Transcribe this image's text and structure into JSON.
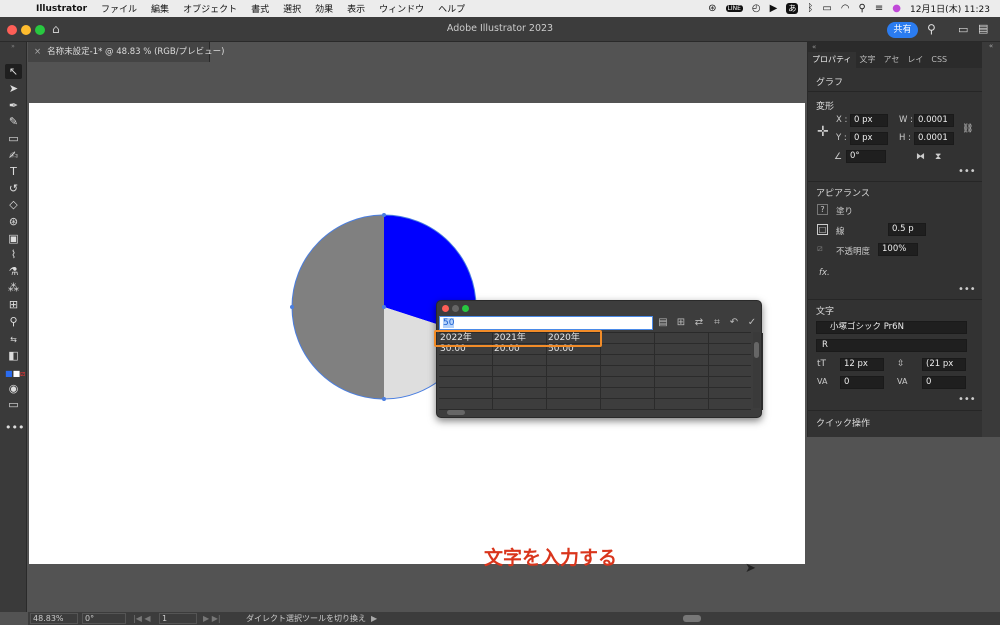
{
  "menubar": {
    "app_name": "Illustrator",
    "items": [
      "ファイル",
      "編集",
      "オブジェクト",
      "書式",
      "選択",
      "効果",
      "表示",
      "ウィンドウ",
      "ヘルプ"
    ],
    "clock": "12月1日(木) 11:23",
    "status_icons": [
      "creative-cloud-icon",
      "line-icon",
      "timer-icon",
      "play-icon",
      "input-method-icon",
      "bluetooth-icon",
      "battery-icon",
      "wifi-icon",
      "spotlight-icon",
      "control-center-icon",
      "siri-icon"
    ],
    "input_method": "あ",
    "line_label": "LINE"
  },
  "window": {
    "title": "Adobe Illustrator 2023",
    "share_label": "共有"
  },
  "document_tab": {
    "close": "×",
    "label": "名称未設定-1* @ 48.83 % (RGB/プレビュー)"
  },
  "canvas": {
    "caption": "文字を入力する",
    "pie_colors": [
      "#0000ff",
      "#dedede",
      "#808080"
    ],
    "pie_values": [
      30,
      20,
      50
    ],
    "selection_color": "#4a7ee0"
  },
  "graph_data": {
    "input_value": "50",
    "rows": [
      [
        "2022年",
        "2021年",
        "2020年",
        "",
        "",
        ""
      ],
      [
        "30.00",
        "20.00",
        "50.00",
        "",
        "",
        ""
      ],
      [
        "",
        "",
        "",
        "",
        "",
        ""
      ],
      [
        "",
        "",
        "",
        "",
        "",
        ""
      ],
      [
        "",
        "",
        "",
        "",
        "",
        ""
      ],
      [
        "",
        "",
        "",
        "",
        "",
        ""
      ],
      [
        "",
        "",
        "",
        "",
        "",
        ""
      ]
    ],
    "highlight_color": "#f28c28"
  },
  "properties_panel": {
    "tabs": [
      "プロパティ",
      "文字",
      "アセ",
      "レイ",
      "CSS"
    ],
    "object_type": "グラフ",
    "transform": {
      "title": "変形",
      "x_label": "X :",
      "x_value": "0 px",
      "y_label": "Y :",
      "y_value": "0 px",
      "w_label": "W :",
      "w_value": "0.0001",
      "h_label": "H :",
      "h_value": "0.0001",
      "angle_value": "0°"
    },
    "appearance": {
      "title": "アピアランス",
      "fill_label": "塗り",
      "stroke_label": "線",
      "stroke_value": "0.5 p",
      "opacity_label": "不透明度",
      "opacity_value": "100%",
      "fx_label": "fx."
    },
    "character": {
      "title": "文字",
      "font_family": "小塚ゴシック Pr6N",
      "font_style": "R",
      "size": "12 px",
      "leading": "(21 px",
      "tracking": "0",
      "kerning": "0"
    },
    "quick_actions": "クイック操作"
  },
  "statusbar": {
    "zoom": "48.83%",
    "rotation": "0°",
    "artboard": "1",
    "tool_hint": "ダイレクト選択ツールを切り換え"
  }
}
